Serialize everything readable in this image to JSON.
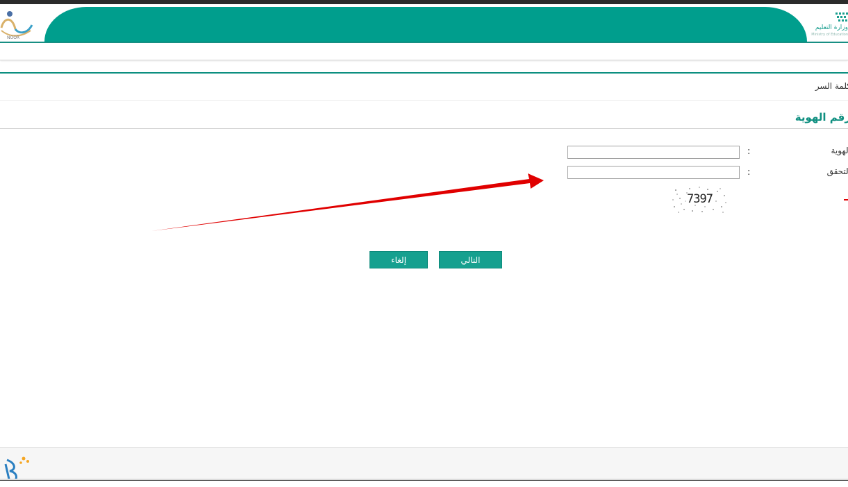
{
  "header": {
    "noor_logo_text": "NOOR",
    "ministry_name": "وزارة التعليم",
    "ministry_name_en": "Ministry of Education"
  },
  "breadcrumb": "كلمة السر",
  "section_title": "رقم الهوية",
  "form": {
    "field1_label": "الهوية",
    "field2_label": "التحقق",
    "colon": ":",
    "field1_value": "",
    "field2_value": "",
    "captcha_code": "7397"
  },
  "buttons": {
    "next_label": "التالي",
    "cancel_label": "إلغاء"
  },
  "colors": {
    "brand_teal": "#009e8d",
    "button_teal": "#16a08f",
    "arrow_red": "#e00000"
  }
}
